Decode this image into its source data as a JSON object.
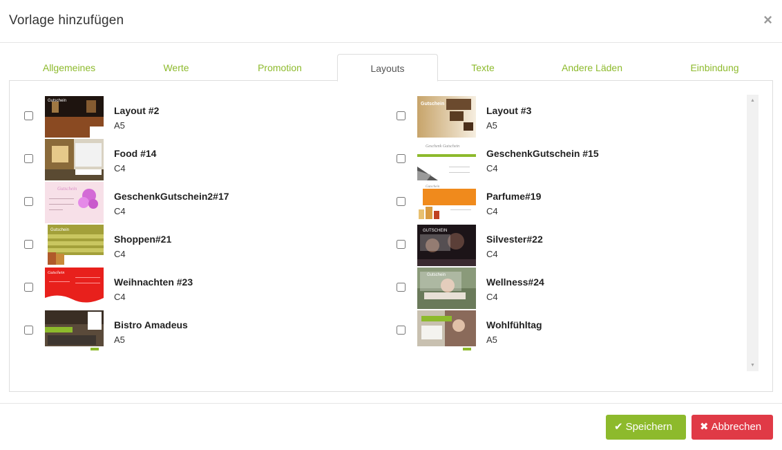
{
  "dialog": {
    "title": "Vorlage hinzufügen",
    "close_icon": "×"
  },
  "tabs": [
    {
      "label": "Allgemeines",
      "active": false
    },
    {
      "label": "Werte",
      "active": false
    },
    {
      "label": "Promotion",
      "active": false
    },
    {
      "label": "Layouts",
      "active": true
    },
    {
      "label": "Texte",
      "active": false
    },
    {
      "label": "Andere Läden",
      "active": false
    },
    {
      "label": "Einbindung",
      "active": false
    }
  ],
  "layouts": [
    {
      "name": "Layout #2",
      "format": "A5",
      "checked": false,
      "thumb_text": "Gutschein"
    },
    {
      "name": "Layout #3",
      "format": "A5",
      "checked": false,
      "thumb_text": "Gutschein"
    },
    {
      "name": "Food #14",
      "format": "C4",
      "checked": false,
      "thumb_text": ""
    },
    {
      "name": "GeschenkGutschein #15",
      "format": "C4",
      "checked": false,
      "thumb_text": "Geschenk Gutschein"
    },
    {
      "name": "GeschenkGutschein2#17",
      "format": "C4",
      "checked": false,
      "thumb_text": "Gutschein"
    },
    {
      "name": "Parfume#19",
      "format": "C4",
      "checked": false,
      "thumb_text": "Gutschein"
    },
    {
      "name": "Shoppen#21",
      "format": "C4",
      "checked": false,
      "thumb_text": "Gutschein"
    },
    {
      "name": "Silvester#22",
      "format": "C4",
      "checked": false,
      "thumb_text": "GUTSCHEIN"
    },
    {
      "name": "Weihnachten #23",
      "format": "C4",
      "checked": false,
      "thumb_text": "Gutschein"
    },
    {
      "name": "Wellness#24",
      "format": "C4",
      "checked": false,
      "thumb_text": "Gutschein"
    },
    {
      "name": "Bistro Amadeus",
      "format": "A5",
      "checked": false,
      "thumb_text": ""
    },
    {
      "name": "Wohlfühltag",
      "format": "A5",
      "checked": false,
      "thumb_text": ""
    }
  ],
  "scrollbar": {
    "up_icon": "▲",
    "down_icon": "▼"
  },
  "footer": {
    "save_label": "Speichern",
    "save_icon": "✔",
    "cancel_label": "Abbrechen",
    "cancel_icon": "✖"
  },
  "colors": {
    "accent": "#8dba2c",
    "danger": "#e03a46",
    "tab_text": "#8dba2c"
  }
}
